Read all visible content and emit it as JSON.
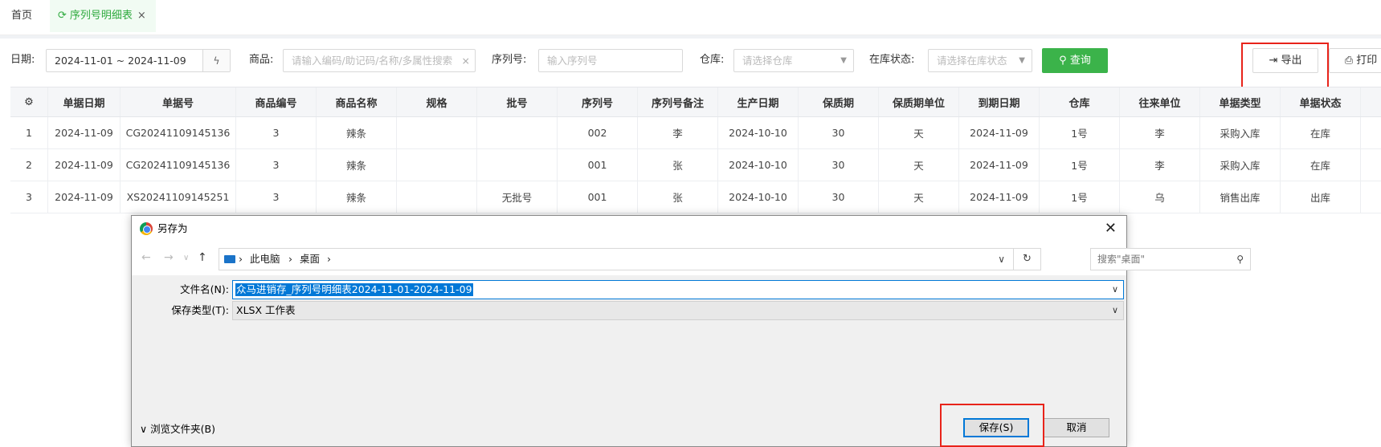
{
  "tabs": {
    "home": "首页",
    "active": "序列号明细表",
    "close": "×"
  },
  "filters": {
    "date_label": "日期:",
    "date_value": "2024-11-01 ~ 2024-11-09",
    "goods_label": "商品:",
    "goods_placeholder": "请输入编码/助记码/名称/多属性搜索",
    "serial_label": "序列号:",
    "serial_placeholder": "输入序列号",
    "warehouse_label": "仓库:",
    "warehouse_placeholder": "请选择仓库",
    "stock_label": "在库状态:",
    "stock_placeholder": "请选择在库状态",
    "query_button": "查询",
    "export_button": "导出",
    "print_button": "打印"
  },
  "table": {
    "columns": [
      "单据日期",
      "单据号",
      "商品编号",
      "商品名称",
      "规格",
      "批号",
      "序列号",
      "序列号备注",
      "生产日期",
      "保质期",
      "保质期单位",
      "到期日期",
      "仓库",
      "往来单位",
      "单据类型",
      "单据状态"
    ],
    "rows": [
      [
        "1",
        "2024-11-09",
        "CG20241109145136",
        "3",
        "辣条",
        "",
        "",
        "002",
        "李",
        "2024-10-10",
        "30",
        "天",
        "2024-11-09",
        "1号",
        "李",
        "采购入库",
        "在库"
      ],
      [
        "2",
        "2024-11-09",
        "CG20241109145136",
        "3",
        "辣条",
        "",
        "",
        "001",
        "张",
        "2024-10-10",
        "30",
        "天",
        "2024-11-09",
        "1号",
        "李",
        "采购入库",
        "在库"
      ],
      [
        "3",
        "2024-11-09",
        "XS20241109145251",
        "3",
        "辣条",
        "",
        "无批号",
        "001",
        "张",
        "2024-10-10",
        "30",
        "天",
        "2024-11-09",
        "1号",
        "乌",
        "销售出库",
        "出库"
      ]
    ]
  },
  "dialog": {
    "title": "另存为",
    "path": [
      "此电脑",
      "桌面"
    ],
    "search_placeholder": "搜索\"桌面\"",
    "filename_label": "文件名(N):",
    "filename_value": "众马进销存_序列号明细表2024-11-01-2024-11-09",
    "filetype_label": "保存类型(T):",
    "filetype_value": "XLSX 工作表",
    "browse_folders": "浏览文件夹(B)",
    "save_button": "保存(S)",
    "cancel_button": "取消"
  },
  "colors": {
    "accent_green": "#3bb34a",
    "highlight_red": "#e8231a",
    "selection_blue": "#0078d7"
  }
}
